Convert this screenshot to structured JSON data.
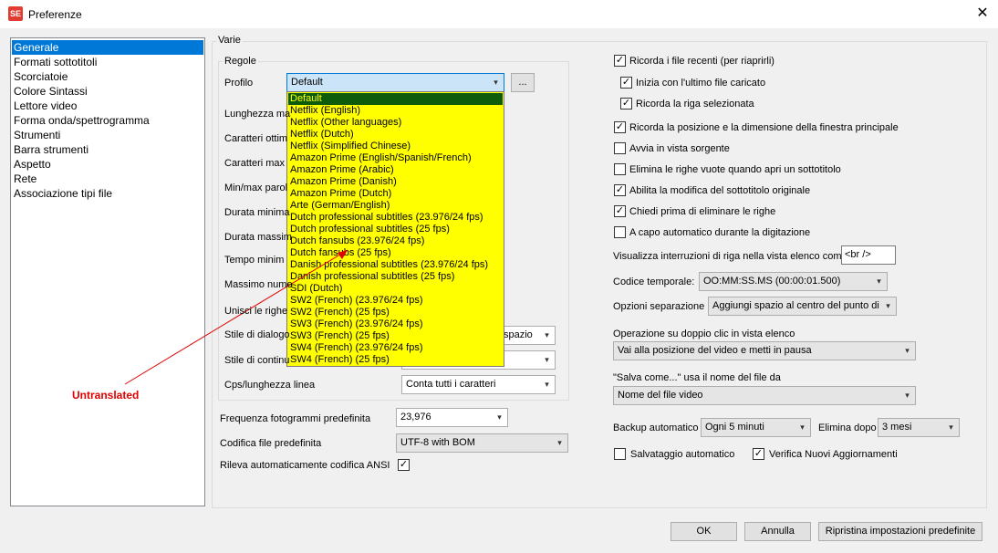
{
  "window": {
    "title": "Preferenze",
    "icon": "subtitle-edit-icon",
    "app_icon_text": "SE"
  },
  "nav": {
    "items": [
      "Generale",
      "Formati sottotitoli",
      "Scorciatoie",
      "Colore Sintassi",
      "Lettore video",
      "Forma onda/spettrogramma",
      "Strumenti",
      "Barra strumenti",
      "Aspetto",
      "Rete",
      "Associazione tipi file"
    ],
    "selected_index": 0
  },
  "varie": {
    "title": "Varie",
    "regole": {
      "title": "Regole",
      "profilo_label": "Profilo",
      "profilo_value": "Default",
      "profilo_more": "...",
      "labels": [
        "Lunghezza ma",
        "Caratteri ottim",
        "Caratteri max",
        "Min/max parol",
        "Durata minima",
        "Durata massim",
        "Tempo minim",
        "Massimo nume",
        "Unisci le righe",
        "Stile di dialogo",
        "Stile di continu",
        "Cps/lunghezza linea"
      ],
      "stile_dialogo_value": "spazio",
      "cps_value": "Conta tutti i caratteri"
    },
    "frequenza_label": "Frequenza fotogrammi predefinita",
    "frequenza_value": "23,976",
    "codifica_label": "Codifica file predefinita",
    "codifica_value": "UTF-8 with BOM",
    "rileva_label": "Rileva automaticamente codifica ANSI",
    "rileva_checked": true
  },
  "profile_dropdown": {
    "items": [
      "Default",
      "Netflix (English)",
      "Netflix (Other languages)",
      "Netflix (Dutch)",
      "Netflix (Simplified Chinese)",
      "Amazon Prime (English/Spanish/French)",
      "Amazon Prime (Arabic)",
      "Amazon Prime (Danish)",
      "Amazon Prime (Dutch)",
      "Arte (German/English)",
      "Dutch professional subtitles (23.976/24 fps)",
      "Dutch professional subtitles (25 fps)",
      "Dutch fansubs (23.976/24 fps)",
      "Dutch fansubs (25 fps)",
      "Danish professional subtitles (23.976/24 fps)",
      "Danish professional subtitles (25 fps)",
      "SDI (Dutch)",
      "SW2 (French) (23.976/24 fps)",
      "SW2 (French) (25 fps)",
      "SW3 (French) (23.976/24 fps)",
      "SW3 (French) (25 fps)",
      "SW4 (French) (23.976/24 fps)",
      "SW4 (French) (25 fps)"
    ],
    "selected_index": 0,
    "background": "#ffff00",
    "selected_background": "#0c5c0c"
  },
  "annotation": {
    "text": "Untranslated",
    "color": "#e00000"
  },
  "right": {
    "checks": [
      {
        "label": "Ricorda i file recenti (per riaprirli)",
        "checked": true
      },
      {
        "label": "Inizia con l'ultimo file caricato",
        "checked": true
      },
      {
        "label": "Ricorda la riga selezionata",
        "checked": true
      },
      {
        "label": "Ricorda la posizione e la dimensione della finestra principale",
        "checked": true
      },
      {
        "label": "Avvia in vista sorgente",
        "checked": false
      },
      {
        "label": "Elimina le righe vuote quando apri un sottotitolo",
        "checked": false
      },
      {
        "label": "Abilita la modifica del sottotitolo originale",
        "checked": true
      },
      {
        "label": "Chiedi prima di eliminare le righe",
        "checked": true
      },
      {
        "label": "A capo automatico durante la digitazione",
        "checked": false
      }
    ],
    "interruzioni_label": "Visualizza interruzioni di riga nella vista elenco come",
    "interruzioni_value": "<br />",
    "codice_label": "Codice temporale:",
    "codice_value": "OO:MM:SS.MS (00:00:01.500)",
    "separazione_label": "Opzioni separazione",
    "separazione_value": "Aggiungi spazio al centro del punto di s",
    "doppio_clic_label": "Operazione su doppio clic in vista elenco",
    "doppio_clic_value": "Vai alla posizione del video e metti in pausa",
    "salva_label": "\"Salva come...\" usa il nome del file da",
    "salva_value": "Nome del file video",
    "backup_label": "Backup automatico",
    "backup_value": "Ogni 5 minuti",
    "elimina_label": "Elimina dopo",
    "elimina_value": "3 mesi",
    "salvataggio_label": "Salvataggio automatico",
    "salvataggio_checked": false,
    "verifica_label": "Verifica Nuovi Aggiornamenti",
    "verifica_checked": true
  },
  "buttons": {
    "ok": "OK",
    "annulla": "Annulla",
    "ripristina": "Ripristina impostazioni predefinite"
  }
}
